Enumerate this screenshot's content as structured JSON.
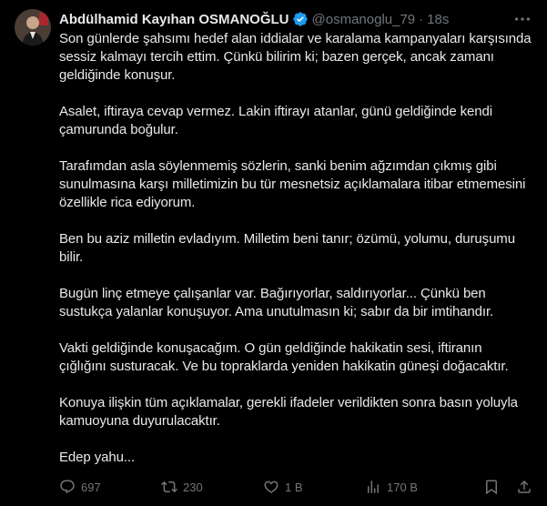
{
  "tweet": {
    "author": {
      "display_name": "Abdülhamid Kayıhan OSMANOĞLU",
      "handle": "@osmanoglu_79",
      "verified": true,
      "verified_color": "#1d9bf0"
    },
    "separator": "·",
    "time": "18s",
    "paragraphs": [
      "Son günlerde şahsımı hedef alan iddialar ve karalama kampanyaları karşısında sessiz kalmayı tercih ettim. Çünkü bilirim ki; bazen gerçek, ancak zamanı geldiğinde konuşur.",
      "Asalet, iftiraya cevap vermez. Lakin iftirayı atanlar, günü geldiğinde kendi çamurunda boğulur.",
      "Tarafımdan asla söylenmemiş sözlerin, sanki benim ağzımdan çıkmış gibi sunulmasına karşı milletimizin bu tür mesnetsiz açıklamalara itibar etmemesini özellikle rica ediyorum.",
      "Ben bu aziz milletin evladıyım. Milletim beni tanır; özümü, yolumu, duruşumu bilir.",
      "Bugün linç etmeye çalışanlar var. Bağırıyorlar, saldırıyorlar... Çünkü ben sustukça yalanlar konuşuyor. Ama unutulmasın ki; sabır da bir imtihandır.",
      "Vakti geldiğinde konuşacağım. O gün geldiğinde hakikatin sesi, iftiranın çığlığını susturacak. Ve bu topraklarda yeniden hakikatin güneşi doğacaktır.",
      "Konuya ilişkin tüm açıklamalar, gerekli ifadeler verildikten sonra basın yoluyla kamuoyuna duyurulacaktır.",
      "Edep yahu..."
    ],
    "actions": {
      "reply_count": "697",
      "repost_count": "230",
      "like_count": "1 B",
      "views_count": "170 B"
    },
    "icons": {
      "more": "more-horizontal-icon",
      "reply": "reply-icon",
      "repost": "repost-icon",
      "like": "heart-icon",
      "views": "views-icon",
      "bookmark": "bookmark-icon",
      "share": "share-icon"
    }
  }
}
